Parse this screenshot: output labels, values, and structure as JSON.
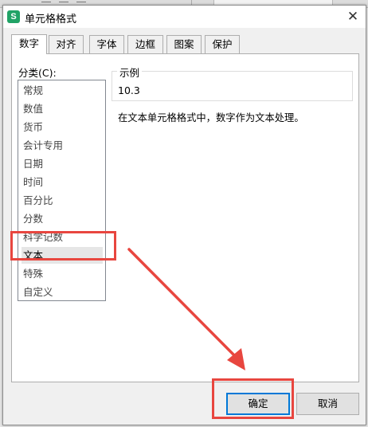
{
  "dialog": {
    "title": "单元格格式",
    "app_icon_letter": "S"
  },
  "tabs": [
    {
      "label": "数字",
      "active": true
    },
    {
      "label": "对齐",
      "active": false
    },
    {
      "label": "字体",
      "active": false
    },
    {
      "label": "边框",
      "active": false
    },
    {
      "label": "图案",
      "active": false
    },
    {
      "label": "保护",
      "active": false
    }
  ],
  "category": {
    "label": "分类(C):",
    "items": [
      "常规",
      "数值",
      "货币",
      "会计专用",
      "日期",
      "时间",
      "百分比",
      "分数",
      "科学记数",
      "文本",
      "特殊",
      "自定义"
    ],
    "selected": "文本"
  },
  "sample": {
    "legend": "示例",
    "value": "10.3"
  },
  "description": "在文本单元格格式中，数字作为文本处理。",
  "buttons": {
    "ok": "确定",
    "cancel": "取消"
  },
  "annotation_color": "#e8463f"
}
